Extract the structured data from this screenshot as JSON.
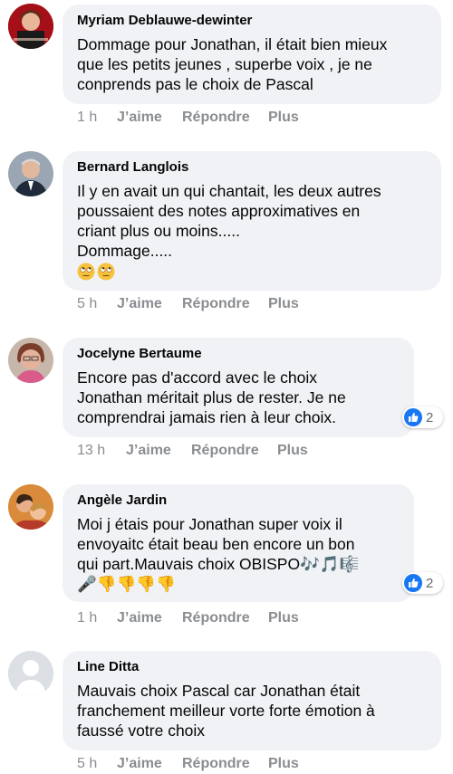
{
  "actions": {
    "like": "J’aime",
    "reply": "Répondre",
    "more": "Plus"
  },
  "colors": {
    "bubble": "#f0f2f5",
    "meta": "#8a8d91",
    "like_blue": "#1877f2"
  },
  "comments": [
    {
      "author": "Myriam Deblauwe-dewinter",
      "lines": [
        "Dommage pour Jonathan, il était bien mieux",
        "que les petits jeunes , superbe voix , je ne",
        "conprends pas le choix de Pascal"
      ],
      "time": "1 h"
    },
    {
      "author": "Bernard Langlois",
      "lines": [
        "Il y en avait un qui chantait, les deux autres",
        "poussaient des notes approximatives en",
        "criant plus ou moins.....",
        "Dommage....."
      ],
      "emojis": [
        "face-with-rolling-eyes",
        "face-with-rolling-eyes"
      ],
      "time": "5 h"
    },
    {
      "author": "Jocelyne Bertaume",
      "lines": [
        "Encore pas d'accord avec le choix",
        "Jonathan méritait plus de rester. Je ne",
        "comprendrai jamais rien à leur choix."
      ],
      "time": "13 h",
      "reaction_count": "2"
    },
    {
      "author": "Angèle Jardin",
      "lines": [
        "Moi j étais pour Jonathan super voix il",
        "envoyaitc était beau ben encore un bon",
        "qui part.Mauvais choix OBISPO🎶🎵🎼",
        "🎤👎👎👎👎"
      ],
      "time": "1 h",
      "reaction_count": "2"
    },
    {
      "author": "Line Ditta",
      "lines": [
        "Mauvais choix Pascal car Jonathan était",
        "franchement meilleur vorte forte émotion à",
        "faussé votre choix"
      ],
      "time": "5 h"
    }
  ]
}
